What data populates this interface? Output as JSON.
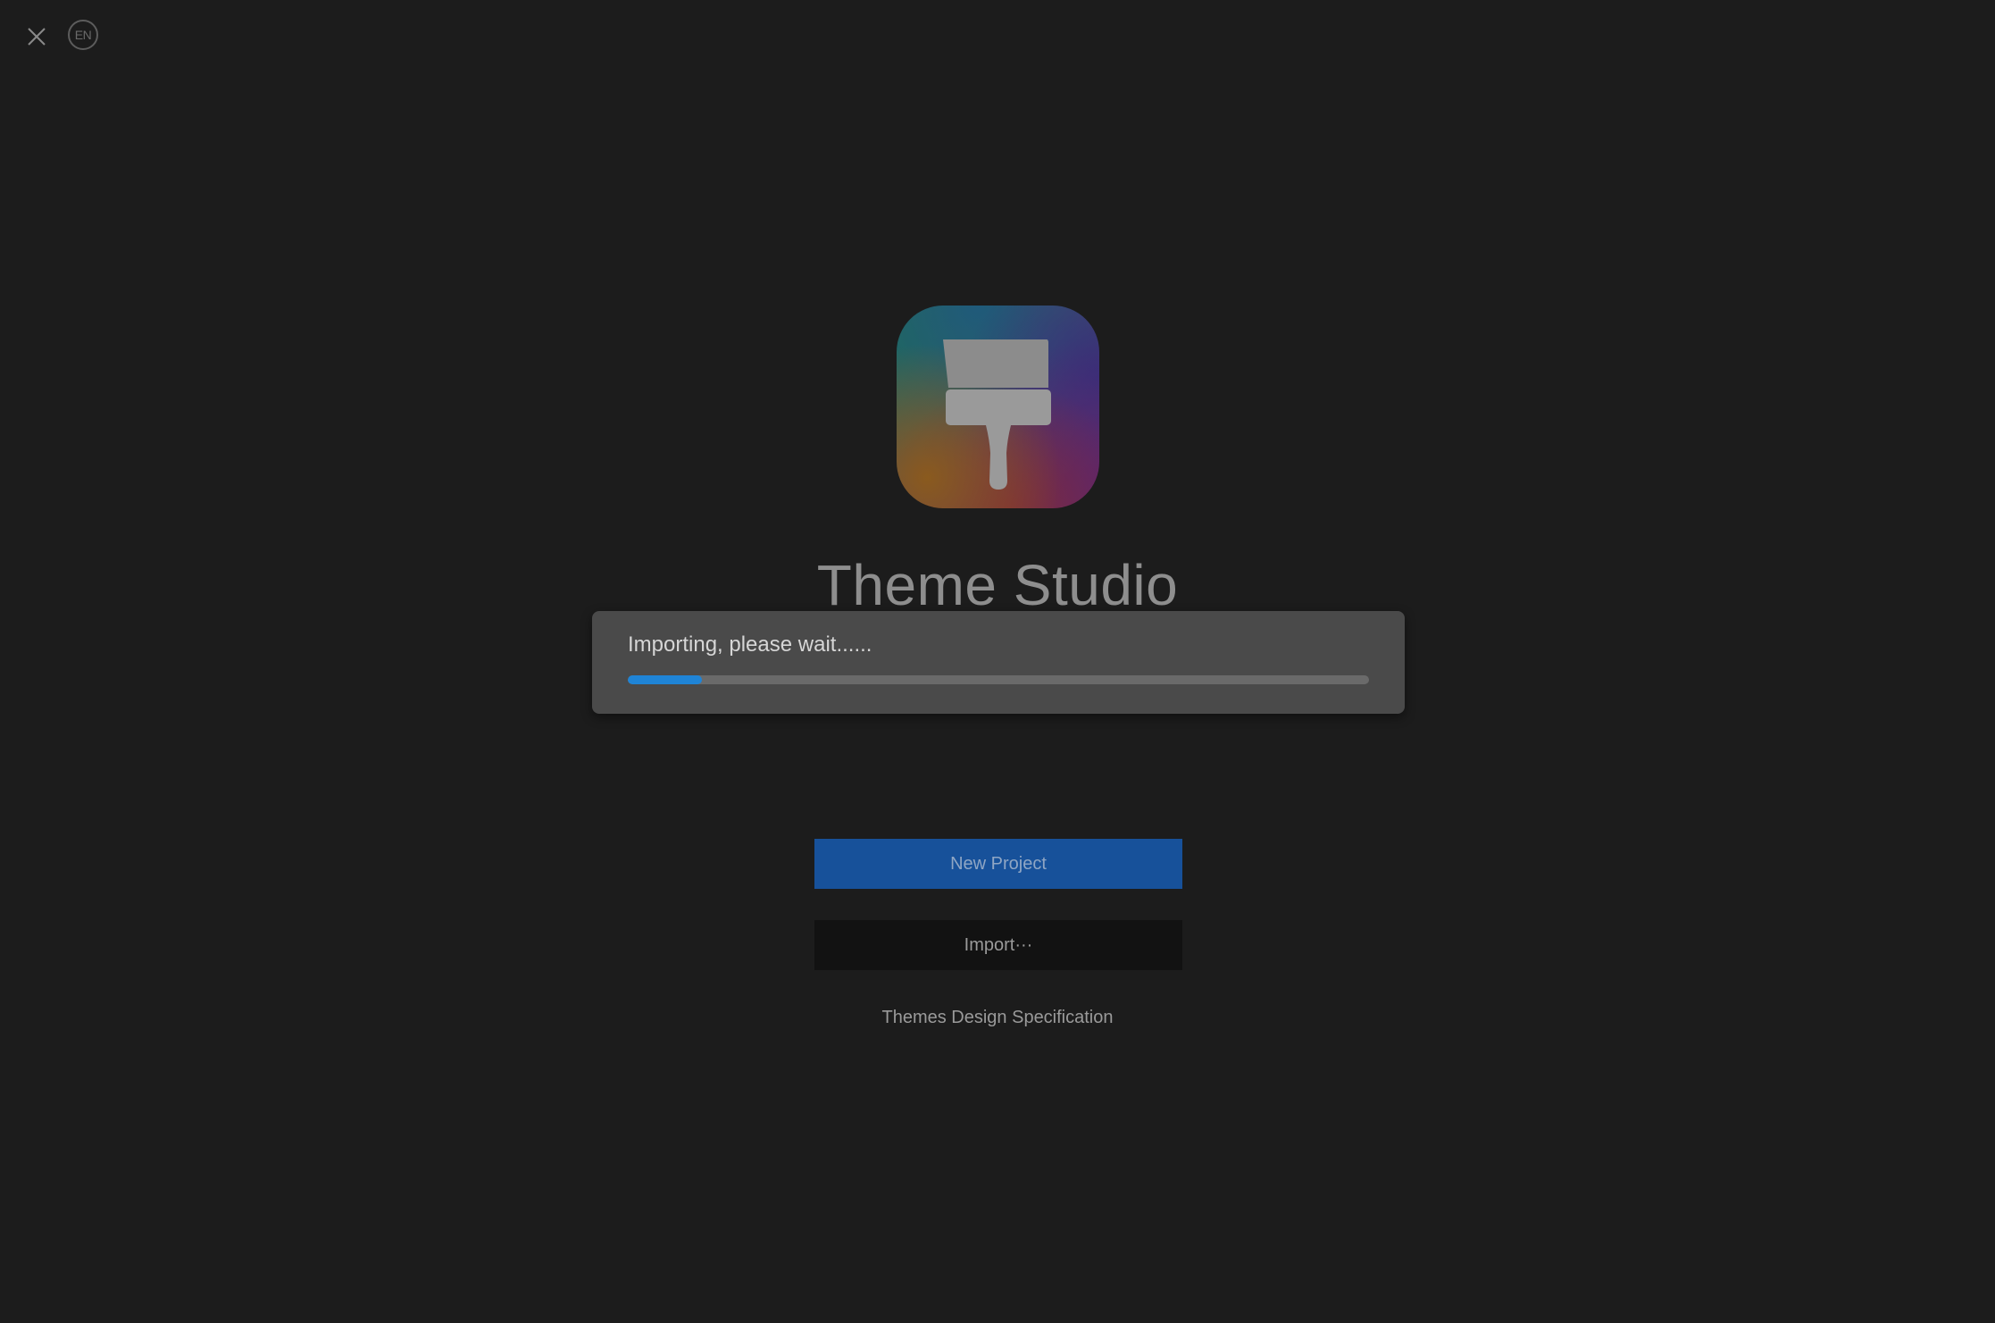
{
  "window": {
    "close_icon": "close-icon",
    "language_label": "EN"
  },
  "app": {
    "icon": "paintbrush-icon",
    "title": "Theme Studio"
  },
  "import_dialog": {
    "message": "Importing, please wait......",
    "progress_fraction": 0.1,
    "accent_color": "#1f84d6"
  },
  "actions": {
    "new_project_label": "New Project",
    "import_label": "Import···",
    "spec_link_label": "Themes Design Specification"
  },
  "colors": {
    "background": "#1c1c1c",
    "primary_button": "#17519a",
    "dialog": "#4a4a4a"
  }
}
